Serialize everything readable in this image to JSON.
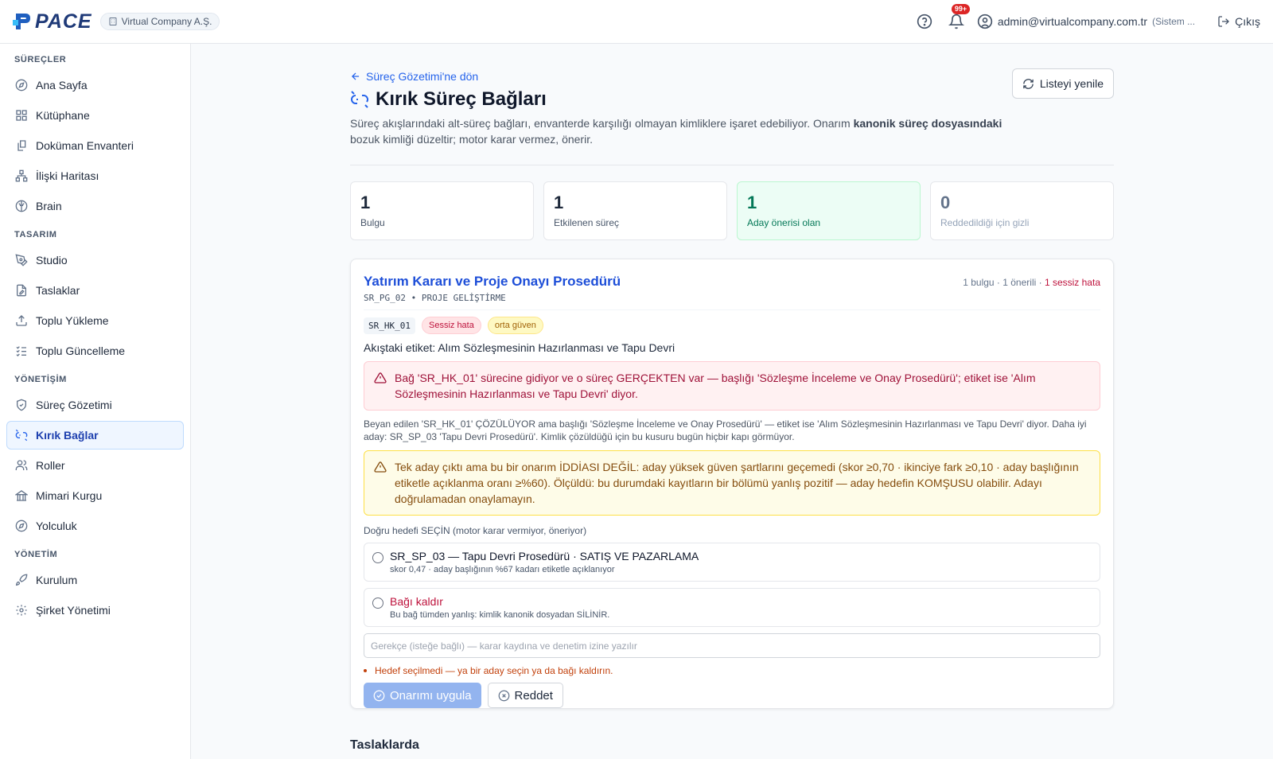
{
  "header": {
    "logo_text": "PACE",
    "company": "Virtual Company A.Ş.",
    "notification_badge": "99+",
    "user_email": "admin@virtualcompany.com.tr",
    "user_role": "(Sistem ...",
    "logout_label": "Çıkış"
  },
  "sidebar": {
    "groups": [
      {
        "label": "SÜREÇLER",
        "items": [
          {
            "label": "Ana Sayfa",
            "icon": "compass-icon"
          },
          {
            "label": "Kütüphane",
            "icon": "grid-icon"
          },
          {
            "label": "Doküman Envanteri",
            "icon": "documents-icon"
          },
          {
            "label": "İlişki Haritası",
            "icon": "network-icon"
          },
          {
            "label": "Brain",
            "icon": "brain-icon"
          }
        ]
      },
      {
        "label": "TASARIM",
        "items": [
          {
            "label": "Studio",
            "icon": "pen-tool-icon"
          },
          {
            "label": "Taslaklar",
            "icon": "file-edit-icon"
          },
          {
            "label": "Toplu Yükleme",
            "icon": "upload-icon"
          },
          {
            "label": "Toplu Güncelleme",
            "icon": "list-checks-icon"
          }
        ]
      },
      {
        "label": "YÖNETİŞİM",
        "items": [
          {
            "label": "Süreç Gözetimi",
            "icon": "shield-icon"
          },
          {
            "label": "Kırık Bağlar",
            "icon": "broken-link-icon",
            "active": true
          },
          {
            "label": "Roller",
            "icon": "users-icon"
          },
          {
            "label": "Mimari Kurgu",
            "icon": "building-icon"
          },
          {
            "label": "Yolculuk",
            "icon": "compass-icon"
          }
        ]
      },
      {
        "label": "YÖNETİM",
        "items": [
          {
            "label": "Kurulum",
            "icon": "rocket-icon"
          },
          {
            "label": "Şirket Yönetimi",
            "icon": "gear-icon"
          }
        ]
      }
    ]
  },
  "page": {
    "back_link": "Süreç Gözetimi'ne dön",
    "refresh_label": "Listeyi yenile",
    "title": "Kırık Süreç Bağları",
    "description_1": "Süreç akışlarındaki alt-süreç bağları, envanterde karşılığı olmayan kimliklere işaret edebiliyor. Onarım ",
    "description_bold": "kanonik süreç dosyasındaki",
    "description_2": " bozuk kimliği düzeltir; motor karar vermez, önerir."
  },
  "stats": [
    {
      "value": "1",
      "label": "Bulgu"
    },
    {
      "value": "1",
      "label": "Etkilenen süreç"
    },
    {
      "value": "1",
      "label": "Aday önerisi olan"
    },
    {
      "value": "0",
      "label": "Reddedildiği için gizli"
    }
  ],
  "finding": {
    "title": "Yatırım Kararı ve Proje Onayı Prosedürü",
    "subtitle": "SR_PG_02 • PROJE GELİŞTİRME",
    "meta_prefix": "1 bulgu · 1 önerili · ",
    "meta_error": "1 sessiz hata",
    "tag_code": "SR_HK_01",
    "tag_severity": "Sessiz hata",
    "tag_confidence": "orta güven",
    "flow_label": "Akıştaki etiket: Alım Sözleşmesinin Hazırlanması ve Tapu Devri",
    "alert_red": "Bağ 'SR_HK_01' sürecine gidiyor ve o süreç GERÇEKTEN var — başlığı 'Sözleşme İnceleme ve Onay Prosedürü'; etiket ise 'Alım Sözleşmesinin Hazırlanması ve Tapu Devri' diyor.",
    "note": "Beyan edilen 'SR_HK_01' ÇÖZÜLÜYOR ama başlığı 'Sözleşme İnceleme ve Onay Prosedürü' — etiket ise 'Alım Sözleşmesinin Hazırlanması ve Tapu Devri' diyor. Daha iyi aday: SR_SP_03 'Tapu Devri Prosedürü'. Kimlik çözüldüğü için bu kusuru bugün hiçbir kapı görmüyor.",
    "alert_amber": "Tek aday çıktı ama bu bir onarım İDDİASI DEĞİL: aday yüksek güven şartlarını geçemedi (skor ≥0,70 · ikinciye fark ≥0,10 · aday başlığının etiketle açıklanma oranı ≥%60). Ölçüldü: bu durumdaki kayıtların bir bölümü yanlış pozitif — aday hedefin KOMŞUSU olabilir. Adayı doğrulamadan onaylamayın.",
    "choose_label": "Doğru hedefi SEÇİN (motor karar vermiyor, öneriyor)",
    "option1_title": "SR_SP_03 — Tapu Devri Prosedürü · SATIŞ VE PAZARLAMA",
    "option1_sub": "skor 0,47 · aday başlığının %67 kadarı etiketle açıklanıyor",
    "option2_title": "Bağı kaldır",
    "option2_sub": "Bu bağ tümden yanlış: kimlik kanonik dosyadan SİLİNİR.",
    "reason_placeholder": "Gerekçe (isteğe bağlı) — karar kaydına ve denetim izine yazılır",
    "warning": "Hedef seçilmedi — ya bir aday seçin ya da bağı kaldırın.",
    "apply_label": "Onarımı uygula",
    "reject_label": "Reddet"
  },
  "next_section": "Taslaklarda"
}
